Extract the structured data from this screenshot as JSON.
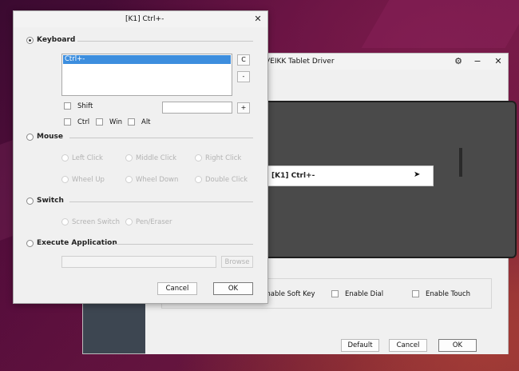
{
  "driver": {
    "title": "VEIKK Tablet Driver",
    "keybar_label": "[K1] Ctrl+-",
    "keybar_arrow": "➤",
    "options": {
      "soft_key": "Enable Soft Key",
      "dial": "Enable Dial",
      "touch": "Enable Touch"
    },
    "buttons": {
      "default": "Default",
      "cancel": "Cancel",
      "ok": "OK"
    }
  },
  "dialog": {
    "title": "[K1] Ctrl+-",
    "keyboard": {
      "label": "Keyboard",
      "selected_item": "Ctrl+-",
      "clear_btn": "C",
      "remove_btn": "-",
      "add_btn": "+",
      "key_value": "",
      "modifiers": {
        "shift": "Shift",
        "ctrl": "Ctrl",
        "win": "Win",
        "alt": "Alt"
      }
    },
    "mouse": {
      "label": "Mouse",
      "options": [
        "Left Click",
        "Middle Click",
        "Right Click",
        "Wheel Up",
        "Wheel Down",
        "Double Click"
      ]
    },
    "switch": {
      "label": "Switch",
      "options": [
        "Screen Switch",
        "Pen/Eraser"
      ]
    },
    "execute": {
      "label": "Execute Application",
      "path_value": "",
      "browse_btn": "Browse"
    },
    "buttons": {
      "cancel": "Cancel",
      "ok": "OK"
    }
  }
}
